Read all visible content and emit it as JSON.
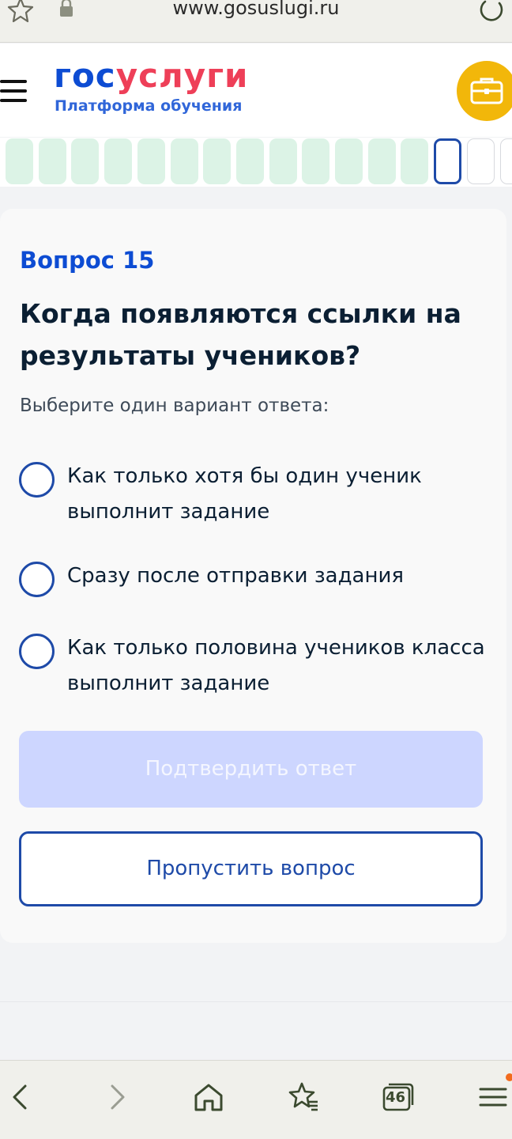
{
  "browser": {
    "url": "www.gosuslugi.ru",
    "tabs_count": "46"
  },
  "header": {
    "logo_part1": "гос",
    "logo_part2": "услуги",
    "subtitle": "Платформа обучения"
  },
  "progress": {
    "answered": 13,
    "current": 14,
    "total_visible": 16
  },
  "question": {
    "number_label": "Вопрос 15",
    "text": "Когда появляются ссылки на результаты учеников?",
    "hint": "Выберите один вариант ответа:",
    "options": [
      {
        "label": "Как только хотя бы один ученик выполнит задание"
      },
      {
        "label": "Сразу после отправки задания"
      },
      {
        "label": "Как только половина учеников класса выполнит задание"
      }
    ]
  },
  "actions": {
    "confirm_label": "Подтвердить ответ",
    "skip_label": "Пропустить вопрос"
  },
  "colors": {
    "brand_blue": "#0d4cd3",
    "brand_red": "#ee3f58",
    "accent_yellow": "#f2b70a",
    "answered_segment": "#dcf3e6",
    "current_border": "#1e4aa8",
    "confirm_disabled_bg": "#cdd6ff"
  }
}
